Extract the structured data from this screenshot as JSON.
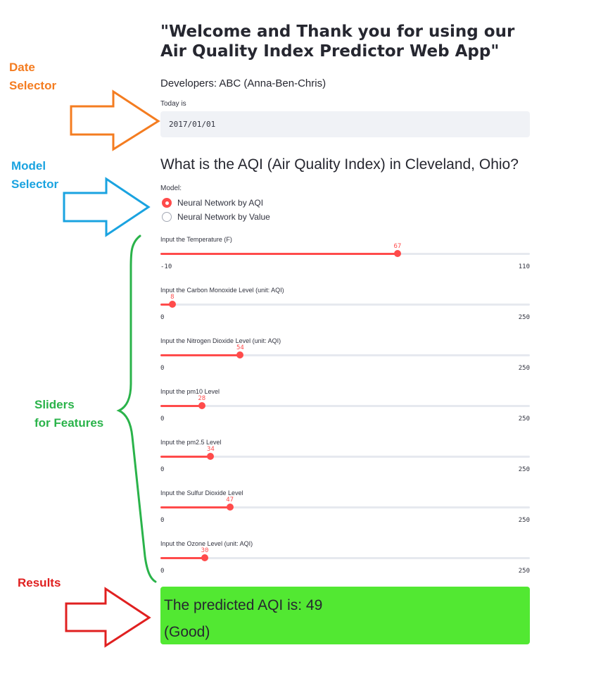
{
  "annotations": {
    "date": {
      "line1": "Date",
      "line2": "Selector",
      "color": "#f47c20"
    },
    "model": {
      "line1": "Model",
      "line2": "Selector",
      "color": "#1aa3e0"
    },
    "sliders": {
      "line1": "Sliders",
      "line2": "for Features",
      "color": "#2ab34a"
    },
    "results": {
      "line1": "Results",
      "color": "#e02020"
    }
  },
  "app": {
    "title": "\"Welcome and Thank you for using our Air Quality Index Predictor Web App\"",
    "developers": "Developers: ABC (Anna-Ben-Chris)",
    "date": {
      "label": "Today is",
      "value": "2017/01/01"
    },
    "question": "What is the AQI (Air Quality Index) in Cleveland, Ohio?",
    "model": {
      "label": "Model:",
      "options": [
        "Neural Network by AQI",
        "Neural Network by Value"
      ],
      "selected": 0
    },
    "sliders": [
      {
        "label": "Input the Temperature (F)",
        "min": -10,
        "max": 110,
        "value": 67,
        "min_label": "-10",
        "max_label": "110",
        "value_label": "67"
      },
      {
        "label": "Input the Carbon Monoxide Level (unit: AQI)",
        "min": 0,
        "max": 250,
        "value": 8,
        "min_label": "0",
        "max_label": "250",
        "value_label": "8"
      },
      {
        "label": "Input the Nitrogen Dioxide Level (unit: AQI)",
        "min": 0,
        "max": 250,
        "value": 54,
        "min_label": "0",
        "max_label": "250",
        "value_label": "54"
      },
      {
        "label": "Input the pm10 Level",
        "min": 0,
        "max": 250,
        "value": 28,
        "min_label": "0",
        "max_label": "250",
        "value_label": "28"
      },
      {
        "label": "Input the pm2.5 Level",
        "min": 0,
        "max": 250,
        "value": 34,
        "min_label": "0",
        "max_label": "250",
        "value_label": "34"
      },
      {
        "label": "Input the Sulfur Dioxide Level",
        "min": 0,
        "max": 250,
        "value": 47,
        "min_label": "0",
        "max_label": "250",
        "value_label": "47"
      },
      {
        "label": "Input the Ozone Level (unit: AQI)",
        "min": 0,
        "max": 250,
        "value": 30,
        "min_label": "0",
        "max_label": "250",
        "value_label": "30"
      }
    ],
    "result": {
      "line1": "The predicted AQI is: 49",
      "line2": "(Good)",
      "color": "#52e832"
    }
  },
  "colors": {
    "accent": "#ff4b4b"
  }
}
